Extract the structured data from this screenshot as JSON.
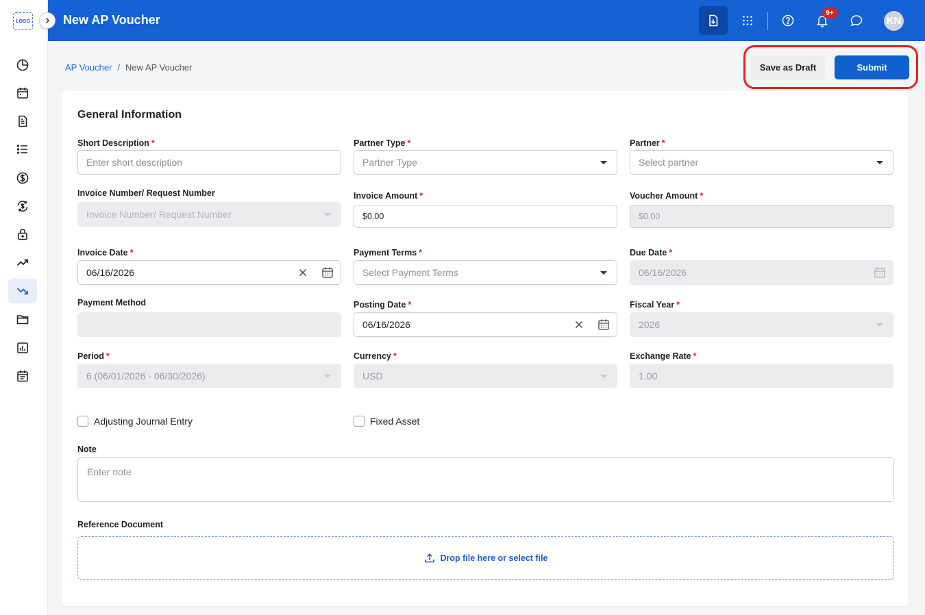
{
  "app": {
    "logo_text": "LOGO",
    "title": "New AP Voucher"
  },
  "header": {
    "notification_badge": "9+",
    "avatar_initials": "KN"
  },
  "breadcrumb": {
    "parent": "AP Voucher",
    "separator": "/",
    "current": "New AP Voucher"
  },
  "actions": {
    "draft_label": "Save as Draft",
    "submit_label": "Submit"
  },
  "form": {
    "section_title": "General Information",
    "short_description": {
      "label": "Short Description",
      "placeholder": "Enter short description"
    },
    "partner_type": {
      "label": "Partner Type",
      "placeholder": "Partner Type"
    },
    "partner": {
      "label": "Partner",
      "placeholder": "Select partner"
    },
    "invoice_number": {
      "label": "Invoice Number/ Request Number",
      "placeholder": "Invoice Number/ Request Number"
    },
    "invoice_amount": {
      "label": "Invoice Amount",
      "value": "$0.00"
    },
    "voucher_amount": {
      "label": "Voucher Amount",
      "value": "$0.00"
    },
    "invoice_date": {
      "label": "Invoice Date",
      "value": "06/16/2026"
    },
    "payment_terms": {
      "label": "Payment Terms",
      "placeholder": "Select Payment Terms"
    },
    "due_date": {
      "label": "Due Date",
      "value": "06/16/2026"
    },
    "payment_method": {
      "label": "Payment Method",
      "value": ""
    },
    "posting_date": {
      "label": "Posting Date",
      "value": "06/16/2026"
    },
    "fiscal_year": {
      "label": "Fiscal Year",
      "value": "2026"
    },
    "period": {
      "label": "Period",
      "value": "6 (06/01/2026 - 06/30/2026)"
    },
    "currency": {
      "label": "Currency",
      "value": "USD"
    },
    "exchange_rate": {
      "label": "Exchange Rate",
      "value": "1.00"
    },
    "adjusting_journal_entry": {
      "label": "Adjusting Journal Entry",
      "checked": false
    },
    "fixed_asset": {
      "label": "Fixed Asset",
      "checked": false
    },
    "note": {
      "label": "Note",
      "placeholder": "Enter note"
    },
    "reference_document": {
      "label": "Reference Document",
      "dropzone_text": "Drop file here or select file"
    },
    "required_marker": "*"
  },
  "icons": {
    "sidebar": [
      "pie-chart-icon",
      "calendar-icon",
      "document-icon",
      "list-icon",
      "dollar-icon",
      "currency-exchange-icon",
      "lock-icon",
      "trending-up-icon",
      "trending-down-icon",
      "folder-icon",
      "report-icon",
      "schedule-icon"
    ],
    "header": [
      "download-file-icon",
      "apps-grid-icon",
      "help-icon",
      "bell-icon",
      "chat-icon"
    ]
  },
  "colors": {
    "brand_blue": "#1463d6",
    "submit_blue": "#1060d0",
    "required_red": "#e02424",
    "highlight_red": "#e8211d"
  }
}
